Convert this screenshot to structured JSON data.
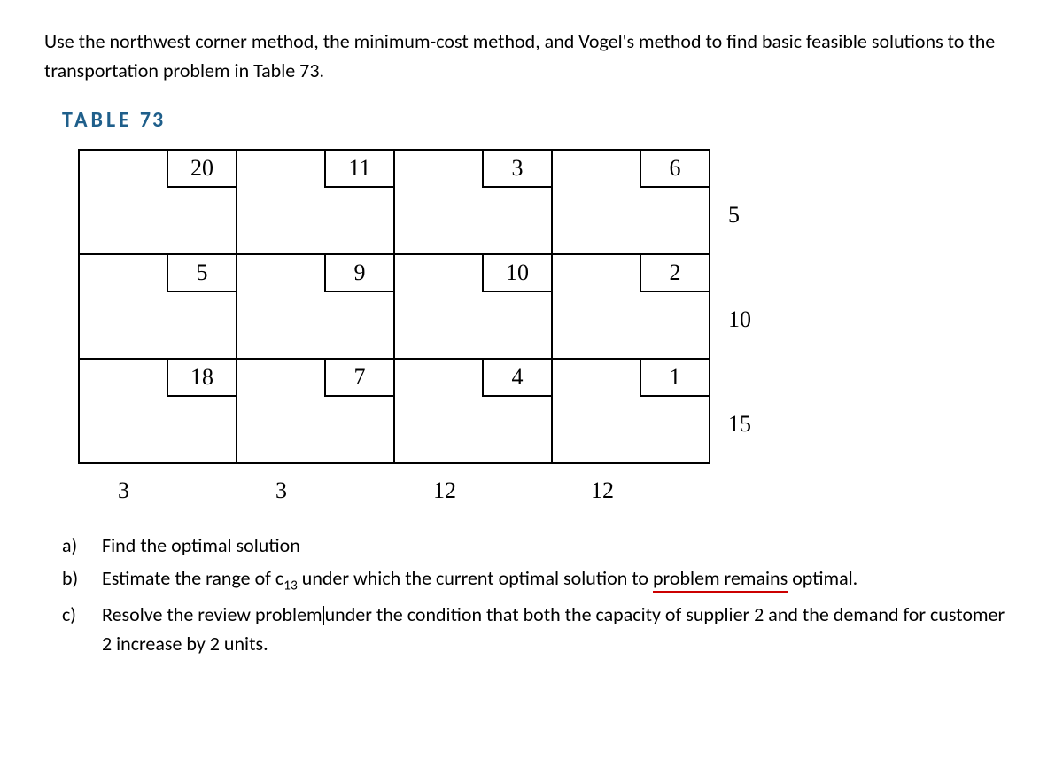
{
  "intro": "Use the northwest corner method, the minimum-cost method, and Vogel's method to find basic feasible solutions to the transportation problem in Table 73.",
  "table_label_text": "TABLE",
  "table_label_num": "73",
  "costs": [
    [
      "20",
      "11",
      "3",
      "6"
    ],
    [
      "5",
      "9",
      "10",
      "2"
    ],
    [
      "18",
      "7",
      "4",
      "1"
    ]
  ],
  "supply": [
    "5",
    "10",
    "15"
  ],
  "demand": [
    "3",
    "3",
    "12",
    "12"
  ],
  "questions": {
    "a": {
      "label": "a)",
      "text": "Find the optimal solution"
    },
    "b": {
      "label": "b)",
      "text_before_c13": "Estimate the range of c",
      "c13_sub": "13",
      "text_after_c13": " under which the current optimal solution to ",
      "underlined": "problem  remains",
      "text_end": " optimal."
    },
    "c": {
      "label": "c)",
      "text_before_cursor": "Resolve the review problem",
      "text_after_cursor": "under the condition that both the capacity of supplier 2 and the demand for customer 2 increase by 2 units."
    }
  }
}
